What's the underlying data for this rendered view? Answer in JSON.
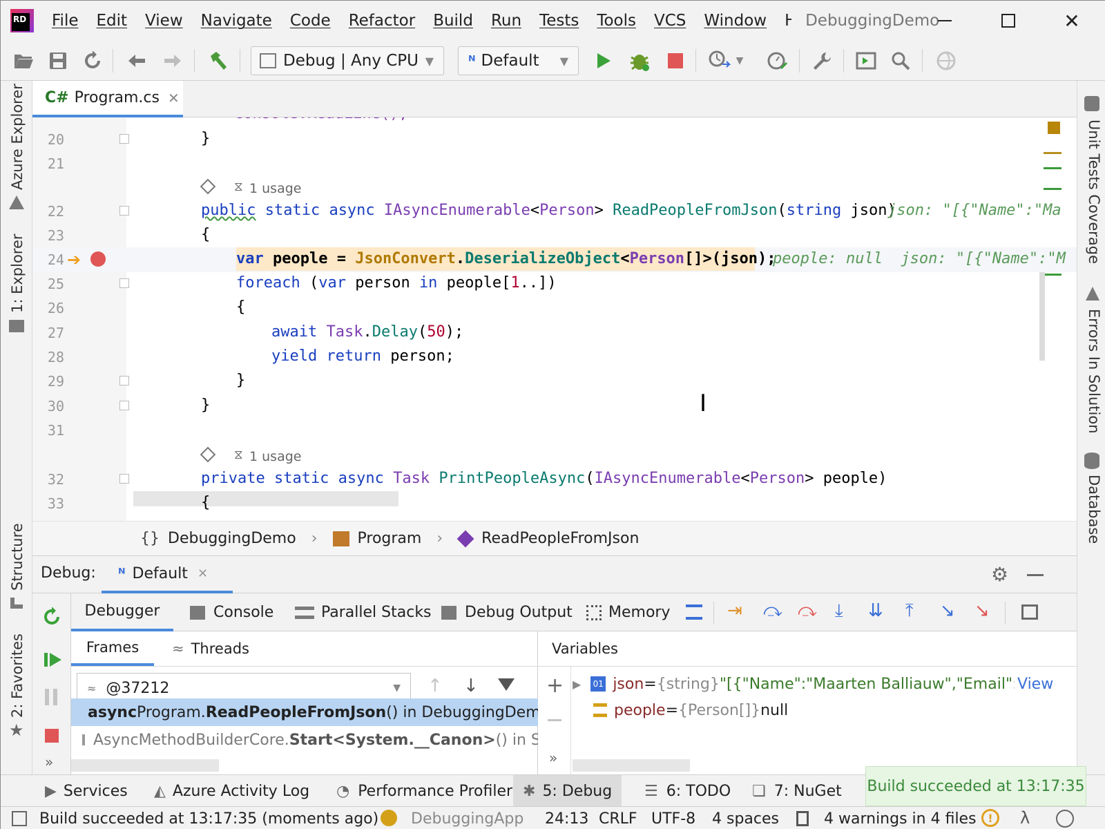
{
  "menu": [
    "File",
    "Edit",
    "View",
    "Navigate",
    "Code",
    "Refactor",
    "Build",
    "Run",
    "Tests",
    "Tools",
    "VCS",
    "Window",
    "Help"
  ],
  "app_title": "DebuggingDemo",
  "toolbar": {
    "config": "Debug | Any CPU",
    "run_config": "Default"
  },
  "left_tools": {
    "azure_explorer": "Azure Explorer",
    "explorer": "1: Explorer",
    "structure": "Structure",
    "favorites": "2: Favorites"
  },
  "right_tools": {
    "unit_tests": "Unit Tests Coverage",
    "errors": "Errors In Solution",
    "database": "Database"
  },
  "editor": {
    "tab": {
      "lang": "C#",
      "name": "Program.cs"
    },
    "usage_hint": "1 usage",
    "line_numbers": [
      "20",
      "21",
      "22",
      "23",
      "24",
      "25",
      "26",
      "27",
      "28",
      "29",
      "30",
      "31",
      "32",
      "33"
    ],
    "lines": {
      "l20": "}",
      "l22_pub": "public",
      "l22_rest1": " static async ",
      "l22_iae": "IAsyncEnumerable",
      "l22_lt": "<",
      "l22_person": "Person",
      "l22_gt": "> ",
      "l22_fn": "ReadPeopleFromJson",
      "l22_args": "(",
      "l22_string": "string",
      "l22_json": " json)",
      "l22_hint": "json: \"[{\"Name\":\"Ma",
      "l23": "{",
      "l24_var": "var",
      "l24_people": " people = ",
      "l24_jc": "JsonConvert",
      "l24_dot": ".",
      "l24_deser": "DeserializeObject",
      "l24_lt": "<",
      "l24_person": "Person",
      "l24_rest": "[]>(json);",
      "l24_hint": "people: null  json: \"[{\"Name\":\"M",
      "l25_foreach": "foreach",
      "l25_open": " (",
      "l25_var": "var",
      "l25_person": " person ",
      "l25_in": "in",
      "l25_rest": " people[",
      "l25_num": "1",
      "l25_end": "..])",
      "l26": "{",
      "l27_await": "await",
      "l27_task": " Task",
      "l27_dot": ".",
      "l27_delay": "Delay",
      "l27_open": "(",
      "l27_num": "50",
      "l27_end": ");",
      "l28_yield": "yield return",
      "l28_rest": " person;",
      "l29": "}",
      "l30": "}",
      "l32_priv": "private static async",
      "l32_task": " Task ",
      "l32_fn": "PrintPeopleAsync",
      "l32_open": "(",
      "l32_iae": "IAsyncEnumerable",
      "l32_lt": "<",
      "l32_person": "Person",
      "l32_rest": "> people)",
      "l33": "{"
    }
  },
  "breadcrumb": [
    "DebuggingDemo",
    "Program",
    "ReadPeopleFromJson"
  ],
  "debug": {
    "label": "Debug:",
    "session": "Default",
    "tabs": [
      "Debugger",
      "Console",
      "Parallel Stacks",
      "Debug Output",
      "Memory"
    ],
    "subtabs": [
      "Frames",
      "Threads"
    ],
    "thread": "@37212",
    "frames": [
      {
        "prefix": "async ",
        "cls": "Program.",
        "method": "ReadPeopleFromJson",
        "tail": "() in DebuggingDem"
      },
      {
        "prefix": "",
        "cls": "AsyncMethodBuilderCore.",
        "method": "Start<System.__Canon>",
        "tail": "() in Sys"
      }
    ],
    "variables_title": "Variables",
    "variables": [
      {
        "name": "json",
        "eq": " = ",
        "type": "{string}",
        "value": " \"[{\"Name\":\"Maarten Balliauw\",\"Email\":\"ma",
        "link": "View"
      },
      {
        "name": "people",
        "eq": " = ",
        "type": "{Person[]}",
        "value": " null",
        "link": ""
      }
    ]
  },
  "bottom_tabs": [
    "Services",
    "Azure Activity Log",
    "Performance Profiler",
    "5: Debug",
    "6: TODO",
    "7: NuGet"
  ],
  "toast": "Build succeeded at 13:17:35",
  "status": {
    "message": "Build succeeded at 13:17:35 (moments ago)",
    "project": "DebuggingApp",
    "position": "24:13",
    "line_ending": "CRLF",
    "encoding": "UTF-8",
    "indent": "4 spaces",
    "warnings": "4 warnings in 4 files"
  },
  "colors": {
    "accent": "#4a8bdc",
    "run_green": "#3aa23a",
    "stop_red": "#e05555",
    "exec_line": "#fde8c8"
  }
}
